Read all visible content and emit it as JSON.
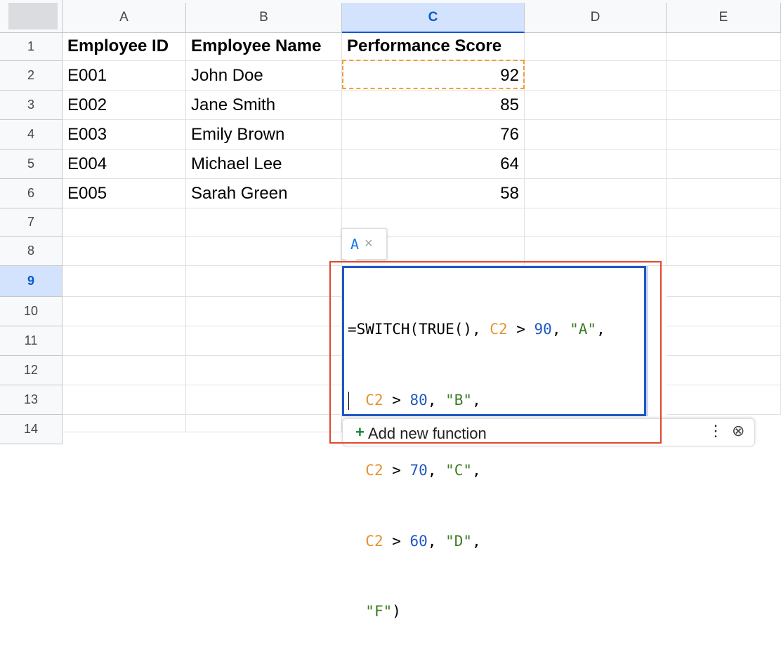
{
  "columns": [
    "A",
    "B",
    "C",
    "D",
    "E"
  ],
  "selected_column": "C",
  "rows": [
    "1",
    "2",
    "3",
    "4",
    "5",
    "6",
    "7",
    "8",
    "9",
    "10",
    "11",
    "12",
    "13",
    "14"
  ],
  "selected_row": "9",
  "table": {
    "headers": [
      "Employee ID",
      "Employee Name",
      "Performance Score"
    ],
    "records": [
      {
        "id": "E001",
        "name": "John Doe",
        "score": "92"
      },
      {
        "id": "E002",
        "name": "Jane Smith",
        "score": "85"
      },
      {
        "id": "E003",
        "name": "Emily Brown",
        "score": "76"
      },
      {
        "id": "E004",
        "name": "Michael Lee",
        "score": "64"
      },
      {
        "id": "E005",
        "name": "Sarah Green",
        "score": "58"
      }
    ]
  },
  "preview_chip": {
    "value": "A",
    "close_glyph": "×"
  },
  "formula": {
    "line1": {
      "a": "=SWITCH(TRUE(), ",
      "ref": "C2",
      "op": " > ",
      "num": "90",
      "sep": ", ",
      "str": "\"A\"",
      "end": ","
    },
    "line2": {
      "indent": "  ",
      "ref": "C2",
      "op": " > ",
      "num": "80",
      "sep": ", ",
      "str": "\"B\"",
      "end": ","
    },
    "line3": {
      "indent": "  ",
      "ref": "C2",
      "op": " > ",
      "num": "70",
      "sep": ", ",
      "str": "\"C\"",
      "end": ","
    },
    "line4": {
      "indent": "  ",
      "ref": "C2",
      "op": " > ",
      "num": "60",
      "sep": ", ",
      "str": "\"D\"",
      "end": ","
    },
    "line5": {
      "indent": "  ",
      "str": "\"F\"",
      "end": ")"
    }
  },
  "suggestion_bar": {
    "plus_icon": "+",
    "label": "Add new function",
    "more_icon": "⋮",
    "close_icon": "⊗"
  },
  "colors": {
    "selection": "#0b57d0",
    "copy_marquee": "#f29d38",
    "annotation": "#e2462f"
  }
}
